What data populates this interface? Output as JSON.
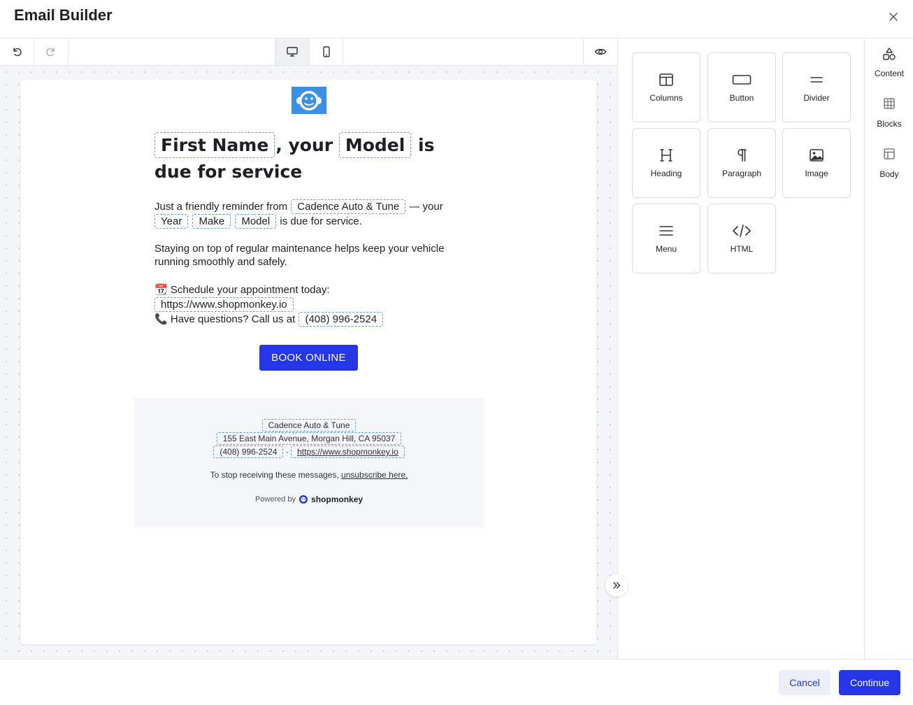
{
  "header": {
    "title": "Email Builder",
    "close_icon": "close-icon"
  },
  "toolbar": {
    "undo_icon": "undo-icon",
    "redo_icon": "redo-icon",
    "desktop_icon": "desktop-icon",
    "mobile_icon": "mobile-icon",
    "preview_icon": "eye-icon"
  },
  "email": {
    "logo_icon": "monkey-logo-icon",
    "headline": {
      "token_first_name": "First Name",
      "text_1": ", your",
      "token_model": "Model",
      "text_2": " is due for service"
    },
    "reminder": {
      "text_1": "Just a friendly reminder from",
      "token_shop": "Cadence Auto & Tune",
      "text_2": "— your",
      "token_year": "Year",
      "token_make": "Make",
      "token_model": "Model",
      "text_3": "is due for service."
    },
    "maintenance": "Staying on top of regular maintenance helps keep your vehicle running smoothly and safely.",
    "schedule": {
      "emoji": "📆",
      "text": "Schedule your appointment today:",
      "token_url": "https://www.shopmonkey.io"
    },
    "questions": {
      "emoji": "📞",
      "text": "Have questions? Call us at",
      "token_phone": "(408) 996-2524"
    },
    "book_button": "BOOK ONLINE",
    "footer": {
      "shop_name": "Cadence Auto & Tune",
      "address": "155 East Main Avenue, Morgan Hill, CA 95037",
      "phone": "(408) 996-2524",
      "separator": "·",
      "website": "https://www.shopmonkey.io",
      "unsubscribe_text": "To stop receiving these messages,",
      "unsubscribe_link": "unsubscribe here.",
      "powered_by": "Powered by",
      "brand": "shopmonkey"
    }
  },
  "panel": {
    "tiles": [
      {
        "label": "Columns",
        "icon": "columns-icon"
      },
      {
        "label": "Button",
        "icon": "button-icon"
      },
      {
        "label": "Divider",
        "icon": "divider-icon"
      },
      {
        "label": "Heading",
        "icon": "heading-icon"
      },
      {
        "label": "Paragraph",
        "icon": "paragraph-icon"
      },
      {
        "label": "Image",
        "icon": "image-icon"
      },
      {
        "label": "Menu",
        "icon": "menu-icon"
      },
      {
        "label": "HTML",
        "icon": "code-icon"
      }
    ],
    "collapse_icon": "double-chevron-right-icon"
  },
  "rail": {
    "items": [
      {
        "label": "Content",
        "icon": "shapes-icon"
      },
      {
        "label": "Blocks",
        "icon": "blocks-icon"
      },
      {
        "label": "Body",
        "icon": "layout-icon"
      }
    ]
  },
  "footer_bar": {
    "cancel": "Cancel",
    "continue": "Continue"
  },
  "colors": {
    "accent": "#2536e8",
    "token_border": "#6b9ad8",
    "logo_bg": "#3d8fe6"
  }
}
